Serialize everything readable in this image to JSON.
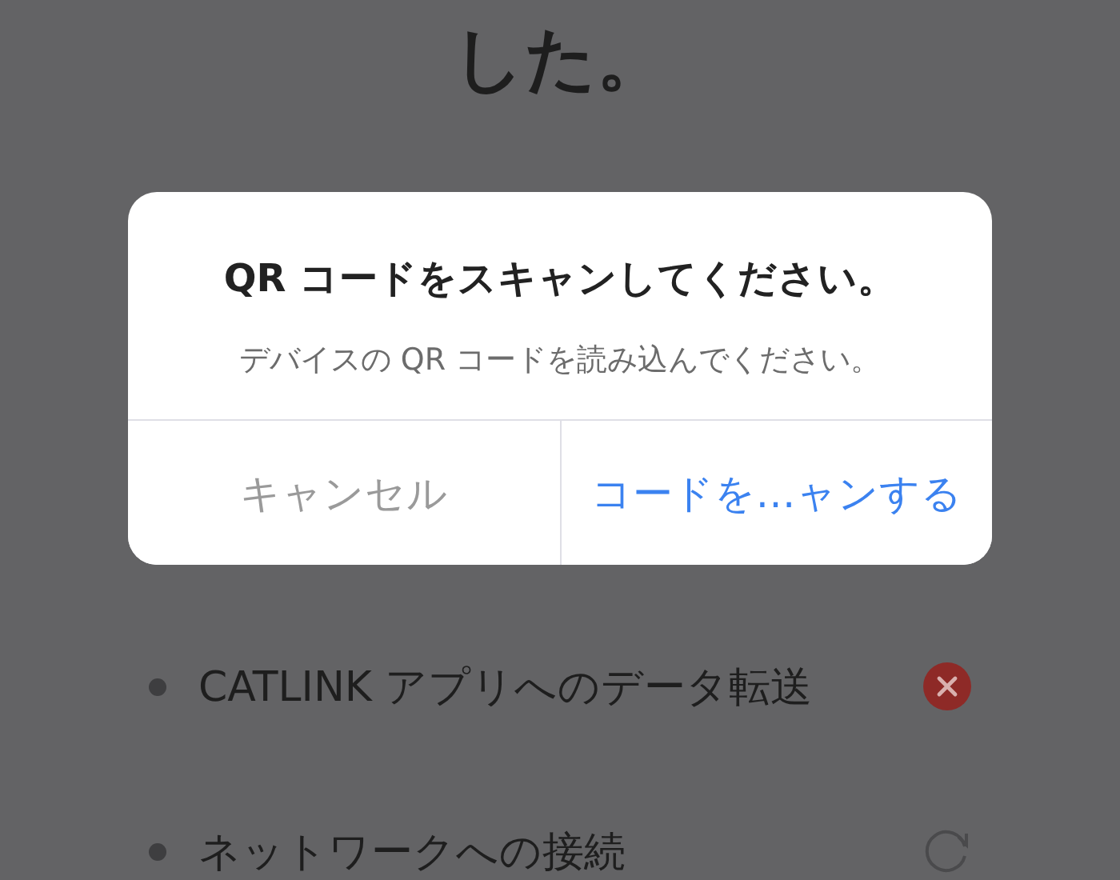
{
  "heading": "した。",
  "dialog": {
    "title": "QR コードをスキャンしてください。",
    "message": "デバイスの QR コードを読み込んでください。",
    "buttons": [
      {
        "label": "キャンセル",
        "kind": "cancel"
      },
      {
        "label": "コードを…ャンする",
        "kind": "primary"
      }
    ]
  },
  "steps": [
    {
      "label": "CATLINK アプリへのデータ転送",
      "kind": "failed"
    },
    {
      "label": "ネットワークへの接続",
      "kind": "loading"
    }
  ]
}
